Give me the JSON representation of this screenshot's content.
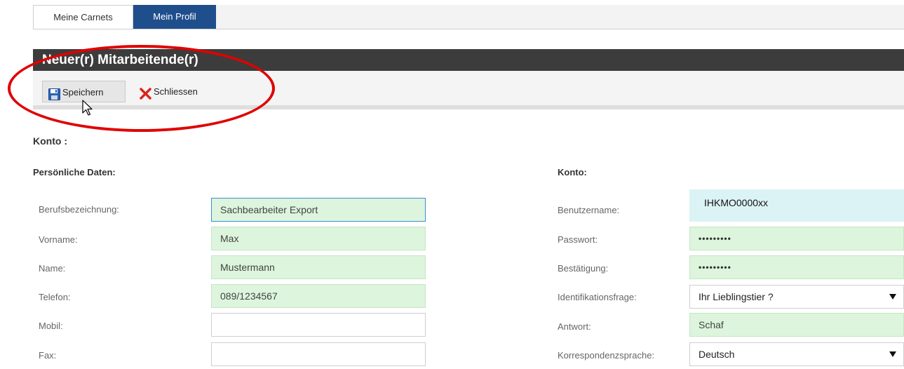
{
  "tabs": [
    {
      "label": "Meine Carnets",
      "active": false
    },
    {
      "label": "Mein Profil",
      "active": true
    }
  ],
  "header": {
    "title": "Neuer(r) Mitarbeitende(r)"
  },
  "toolbar": {
    "save_label": "Speichern",
    "close_label": "Schliessen"
  },
  "section": {
    "title": "Konto :"
  },
  "personal": {
    "heading": "Persönliche Daten:",
    "fields": [
      {
        "label": "Berufsbezeichnung:",
        "value": "Sachbearbeiter Export"
      },
      {
        "label": "Vorname:",
        "value": "Max"
      },
      {
        "label": "Name:",
        "value": "Mustermann"
      },
      {
        "label": "Telefon:",
        "value": "089/1234567"
      },
      {
        "label": "Mobil:",
        "value": ""
      },
      {
        "label": "Fax:",
        "value": ""
      }
    ]
  },
  "account": {
    "heading": "Konto:",
    "fields": [
      {
        "label": "Benutzername:",
        "value": "IHKMO0000xx"
      },
      {
        "label": "Passwort:",
        "value": "•••••••••"
      },
      {
        "label": "Bestätigung:",
        "value": "•••••••••"
      },
      {
        "label": "Identifikationsfrage:",
        "value": "Ihr Lieblingstier ?"
      },
      {
        "label": "Antwort:",
        "value": "Schaf"
      },
      {
        "label": "Korrespondenzsprache:",
        "value": "Deutsch"
      }
    ]
  },
  "colors": {
    "tab_active": "#1f4e8c",
    "titlebar": "#3c3c3c",
    "field_filled": "#dcf5dc",
    "field_info": "#dcf3f5",
    "annotation": "#e00000"
  },
  "icons": {
    "save": "floppy-disk-icon",
    "close": "red-x-icon"
  }
}
